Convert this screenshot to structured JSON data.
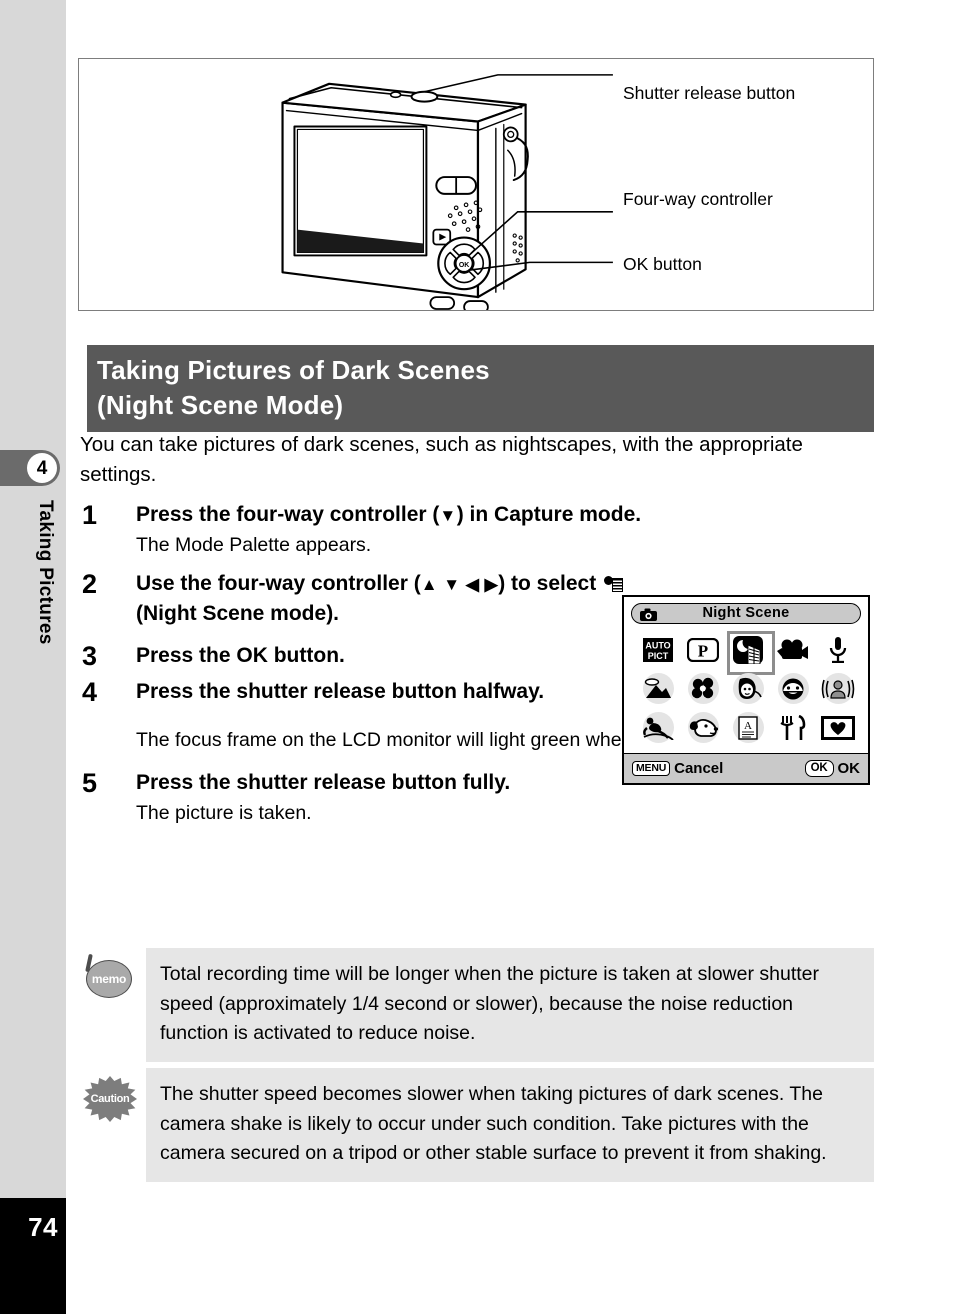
{
  "sidebar": {
    "chapter_number": "4",
    "chapter_label": "Taking Pictures",
    "page_number": "74"
  },
  "figure": {
    "callouts": {
      "shutter": "Shutter release button",
      "fourway": "Four-way controller",
      "ok": "OK button"
    }
  },
  "section": {
    "title_line1": "Taking Pictures of Dark Scenes",
    "title_line2": "(Night Scene Mode)",
    "intro": "You can take pictures of dark scenes, such as nightscapes, with the appropriate settings."
  },
  "steps": [
    {
      "number": "1",
      "title_pre": "Press the four-way controller (",
      "title_arrows": "▼",
      "title_post": ") in Capture mode.",
      "desc": "The Mode Palette appears."
    },
    {
      "number": "2",
      "title_pre": "Use the four-way controller (",
      "title_arrows": "▲ ▼ ◀ ▶",
      "title_post": ") to select",
      "title_post2": "(Night Scene mode).",
      "desc": ""
    },
    {
      "number": "3",
      "title_pre": "Press the OK button.",
      "desc": ""
    },
    {
      "number": "4",
      "title_pre": "Press the shutter release button halfway.",
      "desc": "The focus frame on the LCD monitor will light green when the camera is in focus."
    },
    {
      "number": "5",
      "title_pre": "Press the shutter release button fully.",
      "desc": "The picture is taken."
    }
  ],
  "lcd": {
    "title": "Night Scene",
    "menu_key": "MENU",
    "menu_label": "Cancel",
    "ok_key": "OK",
    "ok_label": "OK",
    "modes": [
      [
        {
          "name": "auto-picture-mode",
          "label": "AUTO PICT",
          "selected": false
        },
        {
          "name": "program-mode",
          "label": "P",
          "selected": false
        },
        {
          "name": "night-scene-mode",
          "label": "Night Scene",
          "selected": true
        },
        {
          "name": "movie-mode",
          "label": "Movie",
          "selected": false
        },
        {
          "name": "voice-recording-mode",
          "label": "Voice Recording",
          "selected": false
        }
      ],
      [
        {
          "name": "landscape-mode",
          "label": "Landscape",
          "selected": false
        },
        {
          "name": "flower-mode",
          "label": "Flower",
          "selected": false
        },
        {
          "name": "portrait-mode",
          "label": "Portrait",
          "selected": false
        },
        {
          "name": "kids-mode",
          "label": "Kids",
          "selected": false
        },
        {
          "name": "self-portrait-mode",
          "label": "Self-portrait",
          "selected": false
        }
      ],
      [
        {
          "name": "surf-and-snow-mode",
          "label": "Surf & Snow",
          "selected": false
        },
        {
          "name": "pet-mode",
          "label": "Pet",
          "selected": false
        },
        {
          "name": "text-mode",
          "label": "Text",
          "selected": false
        },
        {
          "name": "food-mode",
          "label": "Food",
          "selected": false
        },
        {
          "name": "frame-composite-mode",
          "label": "Frame Composite",
          "selected": false
        }
      ]
    ]
  },
  "notes": {
    "memo": {
      "badge": "memo",
      "text": "Total recording time will be longer when the picture is taken at slower shutter speed (approximately 1/4 second or slower), because the noise reduction function is activated to reduce noise."
    },
    "caution": {
      "badge": "Caution",
      "text": "The shutter speed becomes slower when taking pictures of dark scenes. The camera shake is likely to occur under such condition. Take pictures with the camera secured on a tripod or other stable surface to prevent it from shaking."
    }
  },
  "colors": {
    "header_bar": "#595959",
    "sidebar": "#d8d8d8",
    "chapter_tab": "#6b6b6b",
    "note_bg": "#e6e6e6",
    "selected_outline": "#8d8d8d"
  }
}
